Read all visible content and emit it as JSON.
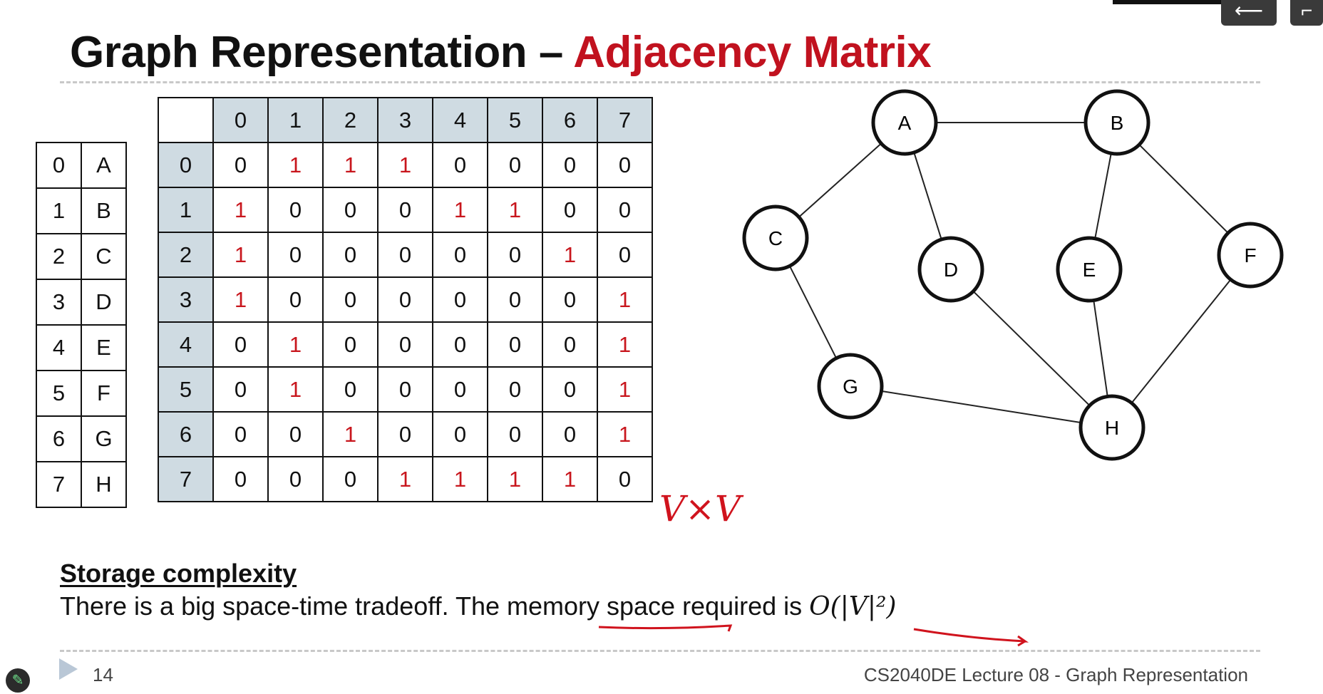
{
  "slide": {
    "title_prefix": "Graph Representation – ",
    "title_accent": "Adjacency Matrix",
    "page_number": "14",
    "course": "CS2040DE Lecture 08 - Graph Representation"
  },
  "index_map": [
    {
      "index": "0",
      "vertex": "A"
    },
    {
      "index": "1",
      "vertex": "B"
    },
    {
      "index": "2",
      "vertex": "C"
    },
    {
      "index": "3",
      "vertex": "D"
    },
    {
      "index": "4",
      "vertex": "E"
    },
    {
      "index": "5",
      "vertex": "F"
    },
    {
      "index": "6",
      "vertex": "G"
    },
    {
      "index": "7",
      "vertex": "H"
    }
  ],
  "matrix": {
    "headers": [
      "0",
      "1",
      "2",
      "3",
      "4",
      "5",
      "6",
      "7"
    ],
    "rows": [
      [
        "0",
        "1",
        "1",
        "1",
        "0",
        "0",
        "0",
        "0"
      ],
      [
        "1",
        "0",
        "0",
        "0",
        "1",
        "1",
        "0",
        "0"
      ],
      [
        "1",
        "0",
        "0",
        "0",
        "0",
        "0",
        "1",
        "0"
      ],
      [
        "1",
        "0",
        "0",
        "0",
        "0",
        "0",
        "0",
        "1"
      ],
      [
        "0",
        "1",
        "0",
        "0",
        "0",
        "0",
        "0",
        "1"
      ],
      [
        "0",
        "1",
        "0",
        "0",
        "0",
        "0",
        "0",
        "1"
      ],
      [
        "0",
        "0",
        "1",
        "0",
        "0",
        "0",
        "0",
        "1"
      ],
      [
        "0",
        "0",
        "0",
        "1",
        "1",
        "1",
        "1",
        "0"
      ]
    ]
  },
  "annotation": {
    "handwritten": "V×V",
    "ink_color": "#d0131d"
  },
  "graph": {
    "nodes": [
      "A",
      "B",
      "C",
      "D",
      "E",
      "F",
      "G",
      "H"
    ],
    "edges": [
      [
        "A",
        "B"
      ],
      [
        "A",
        "C"
      ],
      [
        "A",
        "D"
      ],
      [
        "B",
        "E"
      ],
      [
        "B",
        "F"
      ],
      [
        "C",
        "G"
      ],
      [
        "D",
        "H"
      ],
      [
        "E",
        "H"
      ],
      [
        "F",
        "H"
      ],
      [
        "G",
        "H"
      ]
    ]
  },
  "storage": {
    "heading": "Storage complexity",
    "text": "There is a big space-time tradeoff. The memory space required is ",
    "formula": "O(|V|²)"
  },
  "icons": {
    "play": "play-icon",
    "pen": "pen-icon",
    "back": "back-arrow-icon"
  },
  "colors": {
    "accent": "#c1121f",
    "header_fill": "#cfdbe2",
    "one_value": "#c8161d"
  }
}
